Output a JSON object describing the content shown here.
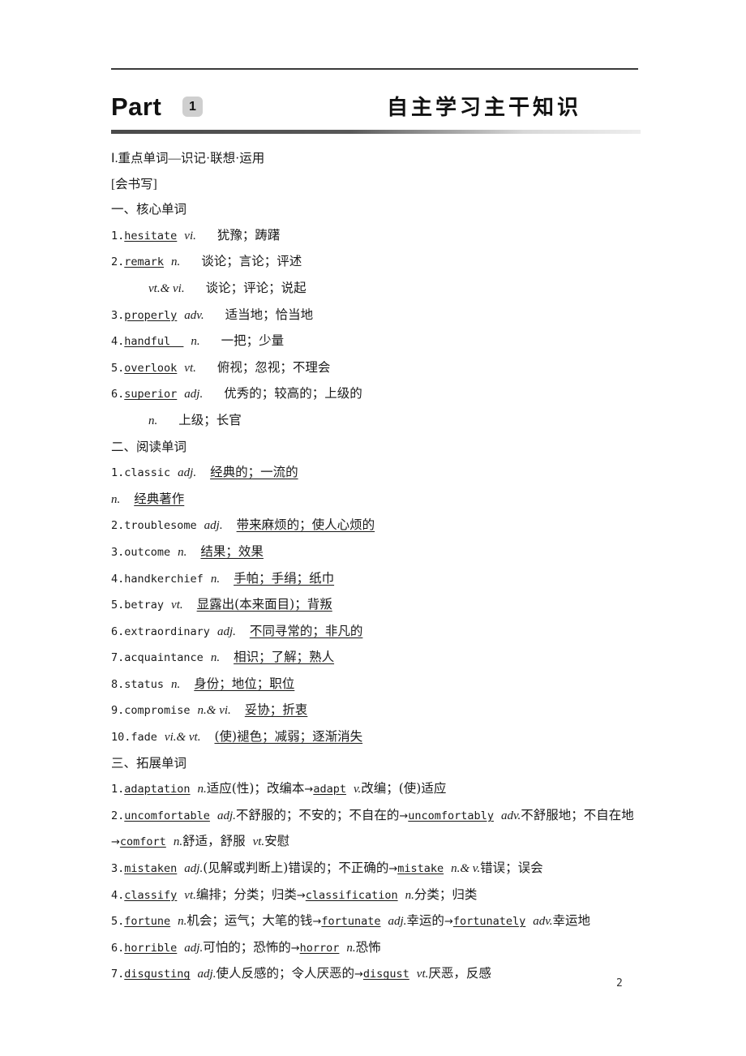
{
  "document": {
    "page_number": "2",
    "top_rule": true
  },
  "header": {
    "part_label": "Part",
    "part_number": "1",
    "title_cn": "自主学习主干知识"
  },
  "section_roman": {
    "heading": "Ⅰ.重点单词—识记·联想·运用",
    "bracket_note": "[会书写]"
  },
  "core_words": {
    "heading": "一、核心单词",
    "items": [
      {
        "num": "1.",
        "word": "hesitate",
        "pos": "vi.",
        "def": "犹豫；踌躇"
      },
      {
        "num": "2.",
        "word": "remark",
        "pos": "n.",
        "def": "谈论；言论；评述"
      },
      {
        "num": "",
        "word": "",
        "pos": "vt.& vi.",
        "def": "谈论；评论；说起"
      },
      {
        "num": "3.",
        "word": "properly",
        "pos": "adv.",
        "def": "适当地；恰当地"
      },
      {
        "num": "4.",
        "word": "handful",
        "pos": "n.",
        "def": "一把；少量"
      },
      {
        "num": "5.",
        "word": "overlook",
        "pos": "vt.",
        "def": "俯视；忽视；不理会"
      },
      {
        "num": "6.",
        "word": "superior",
        "pos": "adj.",
        "def": "优秀的；较高的；上级的"
      },
      {
        "num": "",
        "word": "",
        "pos": "n.",
        "def": "上级；长官"
      }
    ]
  },
  "reading_words": {
    "heading": "二、阅读单词",
    "items": [
      {
        "num": "1.",
        "word": "classic",
        "pos": "adj.",
        "def": "经典的；一流的"
      },
      {
        "num": "",
        "word": "",
        "pos": "n.",
        "def": "经典著作"
      },
      {
        "num": "2.",
        "word": "troublesome",
        "pos": "adj.",
        "def": "带来麻烦的；使人心烦的"
      },
      {
        "num": "3.",
        "word": "outcome",
        "pos": "n.",
        "def": "结果；效果"
      },
      {
        "num": "4.",
        "word": "handkerchief",
        "pos": "n.",
        "def": "手帕；手绢；纸巾"
      },
      {
        "num": "5.",
        "word": "betray",
        "pos": "vt.",
        "def": "显露出(本来面目)；背叛"
      },
      {
        "num": "6.",
        "word": "extraordinary",
        "pos": "adj.",
        "def": "不同寻常的；非凡的"
      },
      {
        "num": "7.",
        "word": "acquaintance",
        "pos": "n.",
        "def": "相识；了解；熟人"
      },
      {
        "num": "8.",
        "word": "status",
        "pos": "n.",
        "def": "身份；地位；职位"
      },
      {
        "num": "9.",
        "word": "compromise",
        "pos": "n.& vi.",
        "def": "妥协；折衷"
      },
      {
        "num": "10.",
        "word": "fade",
        "pos": "vi.& vt.",
        "def": "(使)褪色；减弱；逐渐消失"
      }
    ]
  },
  "extended_words": {
    "heading": "三、拓展单词",
    "arrow": "→",
    "items": [
      {
        "num": "1.",
        "chain": [
          {
            "word": "adaptation",
            "pos": "n.",
            "def": "适应(性)；改编本"
          },
          {
            "word": "adapt",
            "pos": "v.",
            "def": "改编；(使)适应"
          }
        ]
      },
      {
        "num": "2.",
        "chain": [
          {
            "word": "uncomfortable",
            "pos": "adj.",
            "def": "不舒服的；不安的；不自在的"
          },
          {
            "word": "uncomfortably",
            "pos": "adv.",
            "def": "不舒服地；不自在地"
          },
          {
            "word": "comfort",
            "pos": "n.",
            "def": "舒适，舒服",
            "pos2": "vt.",
            "def2": "安慰"
          }
        ]
      },
      {
        "num": "3.",
        "chain": [
          {
            "word": "mistaken",
            "pos": "adj.",
            "def": "(见解或判断上)错误的；不正确的"
          },
          {
            "word": "mistake",
            "pos": "n.& v.",
            "def": "错误；误会"
          }
        ]
      },
      {
        "num": "4.",
        "chain": [
          {
            "word": "classify",
            "pos": "vt.",
            "def": "编排；分类；归类"
          },
          {
            "word": "classification",
            "pos": "n.",
            "def": "分类；归类"
          }
        ]
      },
      {
        "num": "5.",
        "chain": [
          {
            "word": "fortune",
            "pos": "n.",
            "def": "机会；运气；大笔的钱"
          },
          {
            "word": "fortunate",
            "pos": "adj.",
            "def": "幸运的"
          },
          {
            "word": "fortunately",
            "pos": "adv.",
            "def": "幸运地"
          }
        ]
      },
      {
        "num": "6.",
        "chain": [
          {
            "word": "horrible",
            "pos": "adj.",
            "def": "可怕的；恐怖的"
          },
          {
            "word": "horror",
            "pos": "n.",
            "def": "恐怖"
          }
        ]
      },
      {
        "num": "7.",
        "chain": [
          {
            "word": "disgusting",
            "pos": "adj.",
            "def": "使人反感的；令人厌恶的"
          },
          {
            "word": "disgust",
            "pos": "vt.",
            "def": "厌恶，反感"
          }
        ]
      }
    ]
  }
}
